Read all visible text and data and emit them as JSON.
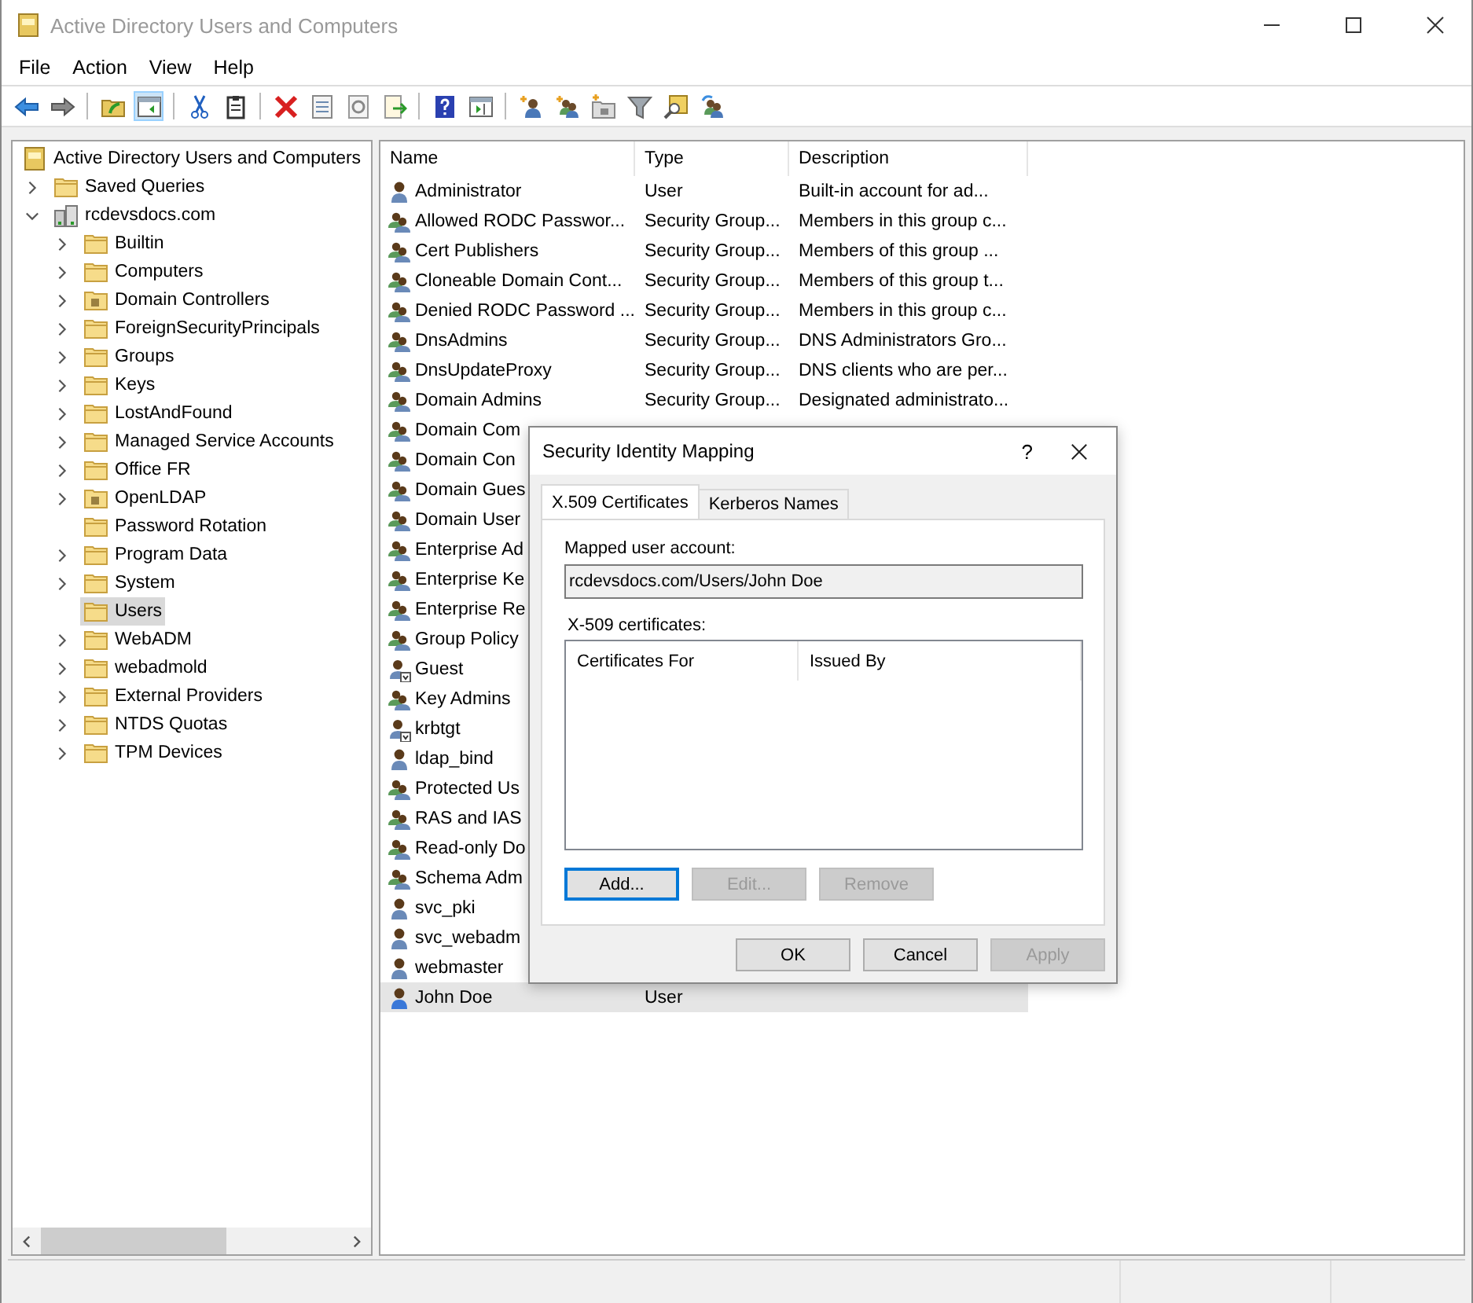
{
  "window": {
    "title": "Active Directory Users and Computers"
  },
  "menu": [
    "File",
    "Action",
    "View",
    "Help"
  ],
  "toolbar": [
    [
      {
        "kind": "back",
        "on": false
      },
      {
        "kind": "forward",
        "on": false
      }
    ],
    [
      {
        "kind": "folder-up",
        "on": false
      },
      {
        "kind": "pane",
        "on": true
      }
    ],
    [
      {
        "kind": "cut",
        "on": false
      },
      {
        "kind": "clipboard",
        "on": false
      }
    ],
    [
      {
        "kind": "delete",
        "on": false
      },
      {
        "kind": "properties",
        "on": false
      },
      {
        "kind": "refresh",
        "on": false
      },
      {
        "kind": "export",
        "on": false
      }
    ],
    [
      {
        "kind": "help",
        "on": false
      },
      {
        "kind": "console",
        "on": false
      }
    ],
    [
      {
        "kind": "new-user",
        "on": false
      },
      {
        "kind": "new-group",
        "on": false
      },
      {
        "kind": "new-ou",
        "on": false
      },
      {
        "kind": "filter",
        "on": false
      },
      {
        "kind": "find",
        "on": false
      },
      {
        "kind": "add-group",
        "on": false
      }
    ]
  ],
  "tree": {
    "label": "Active Directory Users and Computers",
    "kind": "root",
    "selected": false,
    "children": [
      {
        "label": "Saved Queries",
        "kind": "folder",
        "expandable": true,
        "expanded": false,
        "selected": false
      },
      {
        "label": "rcdevsdocs.com",
        "kind": "domain",
        "expandable": true,
        "expanded": true,
        "selected": false,
        "children": [
          {
            "label": "Builtin",
            "kind": "folder",
            "expandable": true,
            "expanded": false,
            "selected": false
          },
          {
            "label": "Computers",
            "kind": "folder",
            "expandable": true,
            "expanded": false,
            "selected": false
          },
          {
            "label": "Domain Controllers",
            "kind": "ou",
            "expandable": true,
            "expanded": false,
            "selected": false
          },
          {
            "label": "ForeignSecurityPrincipals",
            "kind": "folder",
            "expandable": true,
            "expanded": false,
            "selected": false
          },
          {
            "label": "Groups",
            "kind": "folder",
            "expandable": true,
            "expanded": false,
            "selected": false
          },
          {
            "label": "Keys",
            "kind": "folder",
            "expandable": true,
            "expanded": false,
            "selected": false
          },
          {
            "label": "LostAndFound",
            "kind": "folder",
            "expandable": true,
            "expanded": false,
            "selected": false
          },
          {
            "label": "Managed Service Accounts",
            "kind": "folder",
            "expandable": true,
            "expanded": false,
            "selected": false
          },
          {
            "label": "Office FR",
            "kind": "folder",
            "expandable": true,
            "expanded": false,
            "selected": false
          },
          {
            "label": "OpenLDAP",
            "kind": "ou",
            "expandable": true,
            "expanded": false,
            "selected": false
          },
          {
            "label": "Password Rotation",
            "kind": "folder",
            "expandable": false,
            "expanded": false,
            "selected": false
          },
          {
            "label": "Program Data",
            "kind": "folder",
            "expandable": true,
            "expanded": false,
            "selected": false
          },
          {
            "label": "System",
            "kind": "folder",
            "expandable": true,
            "expanded": false,
            "selected": false
          },
          {
            "label": "Users",
            "kind": "folder",
            "expandable": false,
            "expanded": false,
            "selected": true
          },
          {
            "label": "WebADM",
            "kind": "folder",
            "expandable": true,
            "expanded": false,
            "selected": false
          },
          {
            "label": "webadmold",
            "kind": "folder",
            "expandable": true,
            "expanded": false,
            "selected": false
          },
          {
            "label": "External Providers",
            "kind": "folder",
            "expandable": true,
            "expanded": false,
            "selected": false
          },
          {
            "label": "NTDS Quotas",
            "kind": "folder",
            "expandable": true,
            "expanded": false,
            "selected": false
          },
          {
            "label": "TPM Devices",
            "kind": "folder",
            "expandable": true,
            "expanded": false,
            "selected": false
          }
        ]
      }
    ]
  },
  "list": {
    "columns": [
      "Name",
      "Type",
      "Description"
    ],
    "rows": [
      {
        "name": "Administrator",
        "kind": "user",
        "type": "User",
        "description": "Built-in account for ad...",
        "selected": false
      },
      {
        "name": "Allowed RODC Passwor...",
        "kind": "group",
        "type": "Security Group...",
        "description": "Members in this group c...",
        "selected": false
      },
      {
        "name": "Cert Publishers",
        "kind": "group",
        "type": "Security Group...",
        "description": "Members of this group ...",
        "selected": false
      },
      {
        "name": "Cloneable Domain Cont...",
        "kind": "group",
        "type": "Security Group...",
        "description": "Members of this group t...",
        "selected": false
      },
      {
        "name": "Denied RODC Password ...",
        "kind": "group",
        "type": "Security Group...",
        "description": "Members in this group c...",
        "selected": false
      },
      {
        "name": "DnsAdmins",
        "kind": "group",
        "type": "Security Group...",
        "description": "DNS Administrators Gro...",
        "selected": false
      },
      {
        "name": "DnsUpdateProxy",
        "kind": "group",
        "type": "Security Group...",
        "description": "DNS clients who are per...",
        "selected": false
      },
      {
        "name": "Domain Admins",
        "kind": "group",
        "type": "Security Group...",
        "description": "Designated administrato...",
        "selected": false
      },
      {
        "name": "Domain Com",
        "kind": "group",
        "selected": false
      },
      {
        "name": "Domain Con",
        "kind": "group",
        "selected": false
      },
      {
        "name": "Domain Gues",
        "kind": "group",
        "selected": false
      },
      {
        "name": "Domain User",
        "kind": "group",
        "selected": false
      },
      {
        "name": "Enterprise Ad",
        "kind": "group",
        "selected": false
      },
      {
        "name": "Enterprise Ke",
        "kind": "group",
        "selected": false
      },
      {
        "name": "Enterprise Re",
        "kind": "group",
        "selected": false
      },
      {
        "name": "Group Policy",
        "kind": "group",
        "selected": false
      },
      {
        "name": "Guest",
        "kind": "disabled-user",
        "selected": false
      },
      {
        "name": "Key Admins",
        "kind": "group",
        "selected": false
      },
      {
        "name": "krbtgt",
        "kind": "disabled-user",
        "selected": false
      },
      {
        "name": "ldap_bind",
        "kind": "user",
        "selected": false
      },
      {
        "name": "Protected Us",
        "kind": "group",
        "selected": false
      },
      {
        "name": "RAS and IAS",
        "kind": "group",
        "selected": false
      },
      {
        "name": "Read-only Do",
        "kind": "group",
        "selected": false
      },
      {
        "name": "Schema Adm",
        "kind": "group",
        "selected": false
      },
      {
        "name": "svc_pki",
        "kind": "user",
        "selected": false
      },
      {
        "name": "svc_webadm",
        "kind": "user",
        "selected": false
      },
      {
        "name": "webmaster",
        "kind": "user",
        "selected": false
      },
      {
        "name": "John Doe",
        "kind": "user",
        "type": "User",
        "selected": true
      }
    ]
  },
  "dialog": {
    "title": "Security Identity Mapping",
    "help": "?",
    "tabs": [
      {
        "label": "X.509 Certificates",
        "selected": true
      },
      {
        "label": "Kerberos Names",
        "selected": false
      }
    ],
    "mapped_label": "Mapped user account:",
    "mapped_value": "rcdevsdocs.com/Users/John Doe",
    "certs_label": "X-509 certificates:",
    "cert_columns": [
      "Certificates For",
      "Issued By"
    ],
    "cert_buttons": [
      {
        "label": "Add...",
        "disabled": false,
        "focused": true
      },
      {
        "label": "Edit...",
        "disabled": true,
        "focused": false
      },
      {
        "label": "Remove",
        "disabled": true,
        "focused": false
      }
    ],
    "buttons": [
      {
        "label": "OK",
        "disabled": false
      },
      {
        "label": "Cancel",
        "disabled": false
      },
      {
        "label": "Apply",
        "disabled": true
      }
    ]
  }
}
